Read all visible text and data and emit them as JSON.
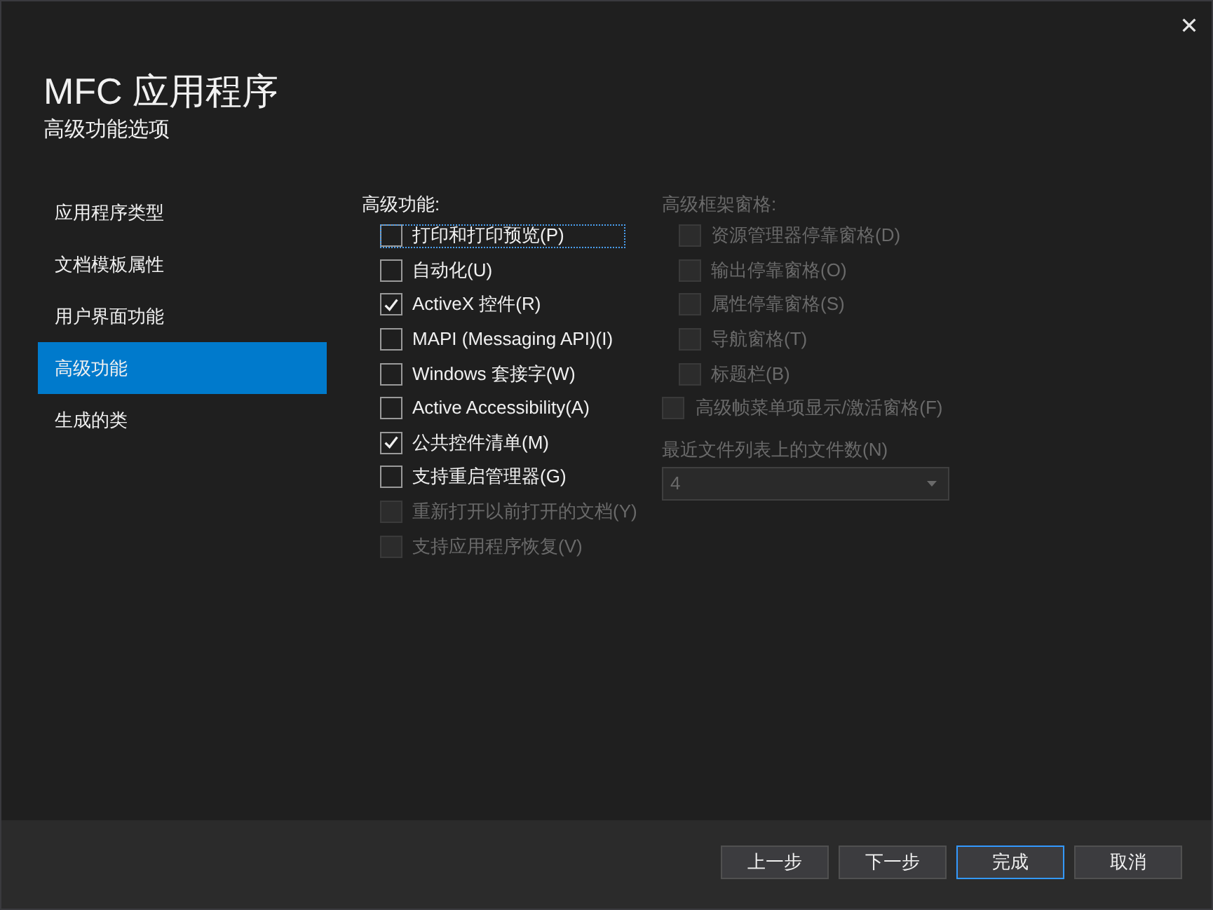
{
  "window": {
    "title": "MFC 应用程序",
    "subtitle": "高级功能选项"
  },
  "sidebar": {
    "items": [
      {
        "label": "应用程序类型",
        "selected": false
      },
      {
        "label": "文档模板属性",
        "selected": false
      },
      {
        "label": "用户界面功能",
        "selected": false
      },
      {
        "label": "高级功能",
        "selected": true
      },
      {
        "label": "生成的类",
        "selected": false
      }
    ]
  },
  "advanced_features": {
    "label": "高级功能:",
    "options": [
      {
        "label": "打印和打印预览(P)",
        "checked": false,
        "disabled": false,
        "focused": true
      },
      {
        "label": "自动化(U)",
        "checked": false,
        "disabled": false,
        "focused": false
      },
      {
        "label": "ActiveX 控件(R)",
        "checked": true,
        "disabled": false,
        "focused": false
      },
      {
        "label": "MAPI (Messaging API)(I)",
        "checked": false,
        "disabled": false,
        "focused": false
      },
      {
        "label": "Windows 套接字(W)",
        "checked": false,
        "disabled": false,
        "focused": false
      },
      {
        "label": "Active Accessibility(A)",
        "checked": false,
        "disabled": false,
        "focused": false
      },
      {
        "label": "公共控件清单(M)",
        "checked": true,
        "disabled": false,
        "focused": false
      },
      {
        "label": "支持重启管理器(G)",
        "checked": false,
        "disabled": false,
        "focused": false
      },
      {
        "label": "重新打开以前打开的文档(Y)",
        "checked": false,
        "disabled": true,
        "focused": false
      },
      {
        "label": "支持应用程序恢复(V)",
        "checked": false,
        "disabled": true,
        "focused": false
      }
    ]
  },
  "frame_panes": {
    "label": "高级框架窗格:",
    "disabled": true,
    "options": [
      {
        "label": "资源管理器停靠窗格(D)",
        "checked": false,
        "disabled": true
      },
      {
        "label": "输出停靠窗格(O)",
        "checked": false,
        "disabled": true
      },
      {
        "label": "属性停靠窗格(S)",
        "checked": false,
        "disabled": true
      },
      {
        "label": "导航窗格(T)",
        "checked": false,
        "disabled": true
      },
      {
        "label": "标题栏(B)",
        "checked": false,
        "disabled": true
      }
    ]
  },
  "frame_menu_option": {
    "label": "高级帧菜单项显示/激活窗格(F)",
    "checked": false,
    "disabled": true
  },
  "recent_files": {
    "label": "最近文件列表上的文件数(N)",
    "value": "4",
    "disabled": true
  },
  "buttons": [
    {
      "label": "上一步",
      "default": false
    },
    {
      "label": "下一步",
      "default": false
    },
    {
      "label": "完成",
      "default": true
    },
    {
      "label": "取消",
      "default": false
    }
  ]
}
